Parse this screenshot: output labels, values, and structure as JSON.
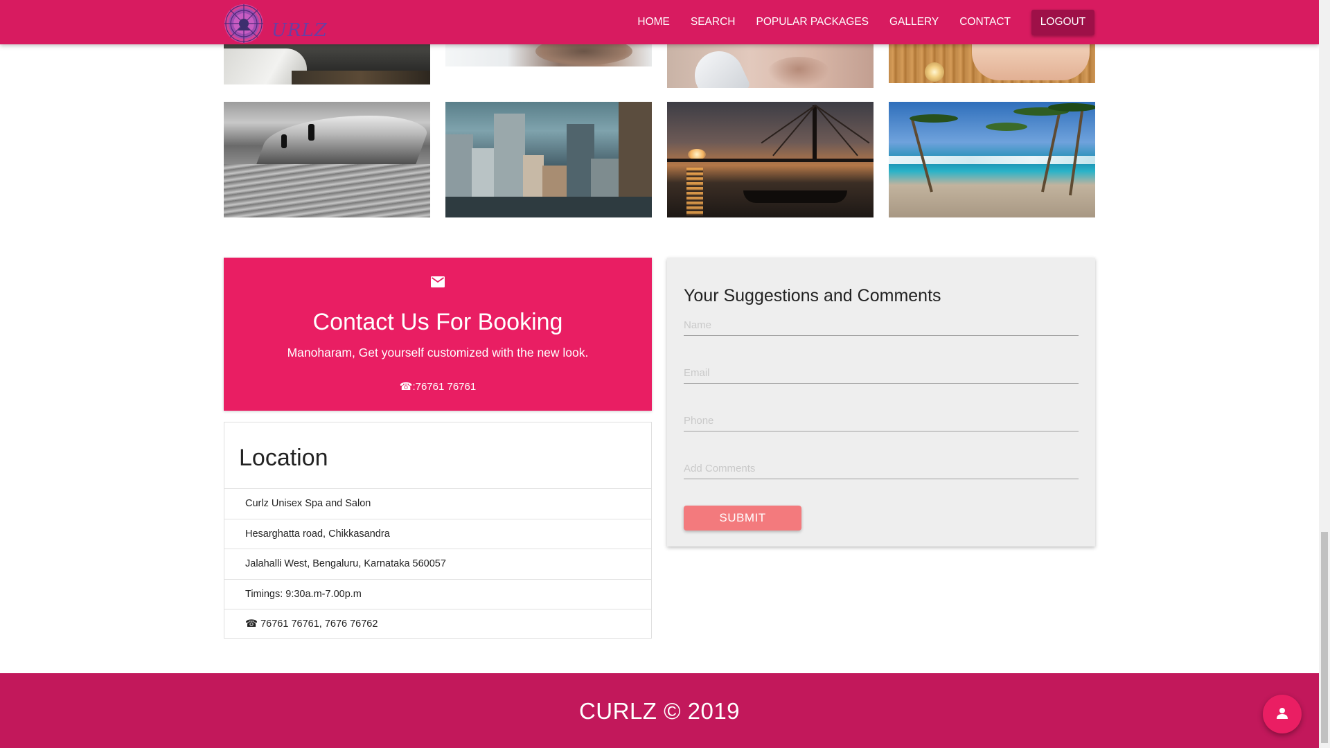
{
  "brand": {
    "logo_text": "URLZ",
    "primary_color": "#d81b60",
    "accent_color": "#e91e63",
    "footer_color": "#c2185b",
    "button_color": "#f37a7d"
  },
  "nav": {
    "items": [
      {
        "label": "HOME"
      },
      {
        "label": "SEARCH"
      },
      {
        "label": "POPULAR PACKAGES"
      },
      {
        "label": "GALLERY"
      },
      {
        "label": "CONTACT"
      }
    ],
    "logout_label": "LOGOUT"
  },
  "gallery": {
    "images": [
      {
        "subject": "office"
      },
      {
        "subject": "beard-trim"
      },
      {
        "subject": "facial"
      },
      {
        "subject": "pedicure"
      },
      {
        "subject": "surfing"
      },
      {
        "subject": "city"
      },
      {
        "subject": "bridge-sunset"
      },
      {
        "subject": "beach-palms"
      }
    ]
  },
  "contact": {
    "icon": "mail-icon",
    "title": "Contact Us For Booking",
    "subtitle": "Manoharam, Get yourself customized with the new look.",
    "phone_glyph": "☎",
    "phone": ":76761 76761"
  },
  "location": {
    "title": "Location",
    "lines": [
      "Curlz Unisex Spa and Salon",
      "Hesarghatta road, Chikkasandra",
      "Jalahalli West, Bengaluru, Karnataka 560057",
      "Timings: 9:30a.m-7.00p.m",
      "☎ 76761 76761, 7676 76762"
    ]
  },
  "suggestions": {
    "title": "Your Suggestions and Comments",
    "name_placeholder": "Name",
    "email_placeholder": "Email",
    "phone_placeholder": "Phone",
    "comments_placeholder": "Add Comments",
    "submit_label": "SUBMIT"
  },
  "footer": {
    "text": "CURLZ © 2019"
  },
  "fab": {
    "icon": "person-icon"
  }
}
